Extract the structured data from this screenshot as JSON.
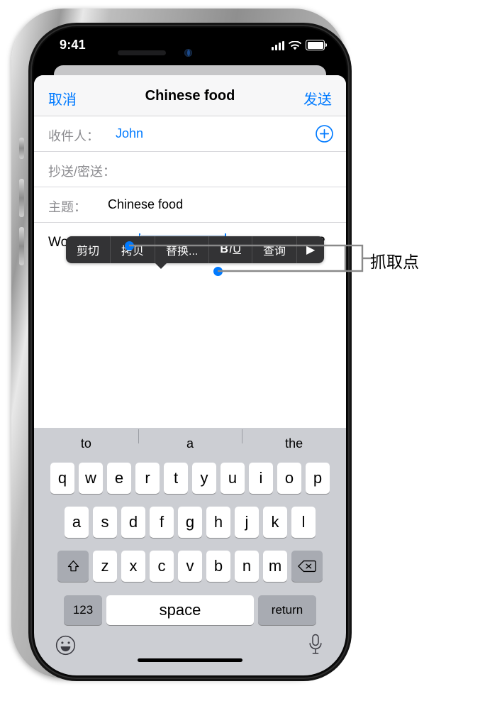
{
  "status_bar": {
    "time": "9:41",
    "cellular_icon": "signal-bars-icon",
    "wifi_icon": "wifi-icon",
    "battery_icon": "battery-full-icon"
  },
  "nav_bar": {
    "cancel_label": "取消",
    "title": "Chinese food",
    "send_label": "发送"
  },
  "fields": {
    "to_label": "收件人：",
    "to_value": "John",
    "cc_bcc_label": "抄送/密送：",
    "subject_label": "主题：",
    "subject_value": "Chinese food",
    "add_contact_icon": "plus-circle-icon"
  },
  "body": {
    "before_selection": "Would you like ",
    "selection": "Mandarin food",
    "after_selection": " for lunch today?"
  },
  "edit_menu": {
    "items": [
      {
        "label": "剪切",
        "name": "cut"
      },
      {
        "label": "拷贝",
        "name": "copy"
      },
      {
        "label": "替换...",
        "name": "replace"
      },
      {
        "label": "BIU",
        "name": "format"
      },
      {
        "label": "查询",
        "name": "look-up"
      },
      {
        "label": "▶",
        "name": "more"
      }
    ],
    "format_bold": "B",
    "format_italic": "I",
    "format_underline": "U",
    "more_arrow": "▶"
  },
  "keyboard": {
    "suggestions": [
      "to",
      "a",
      "the"
    ],
    "row1": [
      "q",
      "w",
      "e",
      "r",
      "t",
      "y",
      "u",
      "i",
      "o",
      "p"
    ],
    "row2": [
      "a",
      "s",
      "d",
      "f",
      "g",
      "h",
      "j",
      "k",
      "l"
    ],
    "row3": [
      "z",
      "x",
      "c",
      "v",
      "b",
      "n",
      "m"
    ],
    "shift_icon": "shift-up-arrow-icon",
    "backspace_icon": "delete-backward-icon",
    "numeric_label": "123",
    "space_label": "space",
    "return_label": "return",
    "emoji_icon": "emoji-smiley-icon",
    "dictation_icon": "microphone-icon"
  },
  "annotation": {
    "label": "抓取点"
  },
  "colors": {
    "accent_blue": "#007aff",
    "selection_highlight": "#cfdeef",
    "menu_background": "#333335",
    "keyboard_background": "#ccced3",
    "key_white": "#ffffff",
    "key_gray": "#a8abb2"
  }
}
